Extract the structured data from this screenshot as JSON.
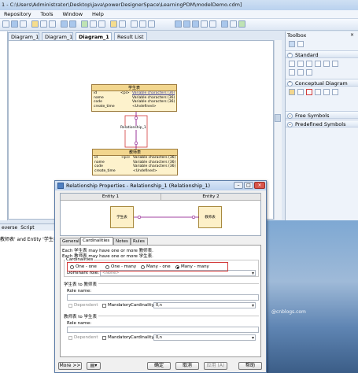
{
  "window": {
    "title": "1 - C:\\Users\\Administrator\\Desktop\\java\\powerDesignerSpace\\LearningPDM\\modelDemo.cdm]"
  },
  "menu": [
    "Repository",
    "Tools",
    "Window",
    "Help"
  ],
  "tabs": [
    {
      "label": "Diagram_1"
    },
    {
      "label": "Diagram_1"
    },
    {
      "label": "Diagram_1"
    },
    {
      "label": "Result List"
    }
  ],
  "diagram": {
    "entity_top": {
      "name": "学生表",
      "rows": [
        {
          "name": "id",
          "key": "<pi>",
          "type": "Variable characters (36)"
        },
        {
          "name": "name",
          "key": "",
          "type": "Variable characters (36)"
        },
        {
          "name": "code",
          "key": "",
          "type": "Variable characters (36)"
        },
        {
          "name": "create_time",
          "key": "",
          "type": "<Undefined>"
        }
      ]
    },
    "relationship_label": "Relationship_1",
    "entity_bottom": {
      "name": "教师表",
      "rows": [
        {
          "name": "id",
          "key": "<pi>",
          "type": "Variable characters (36)"
        },
        {
          "name": "name",
          "key": "",
          "type": "Variable characters (36)"
        },
        {
          "name": "code",
          "key": "",
          "type": "Variable characters (36)"
        },
        {
          "name": "create_time",
          "key": "",
          "type": "<Undefined>"
        }
      ]
    }
  },
  "toolbox": {
    "title": "Toolbox",
    "sections": [
      {
        "label": "Standard",
        "collapsed": false
      },
      {
        "label": "Conceptual Diagram",
        "collapsed": false
      },
      {
        "label": "Free Symbols",
        "collapsed": true
      },
      {
        "label": "Predefined Symbols",
        "collapsed": true
      }
    ]
  },
  "bottom_panel": {
    "tabs": [
      "everse",
      "Script"
    ],
    "output_text": "教师表' and Entity '学生表"
  },
  "watermark": "@cnblogs.com",
  "dialog": {
    "title": "Relationship Properties - Relationship_1 (Relationship_1)",
    "preview": {
      "entity1_header": "Entity 1",
      "entity2_header": "Entity 2",
      "entity1": "学生表",
      "entity2": "教师表"
    },
    "tabs": [
      "General",
      "Cardinalities",
      "Notes",
      "Rules"
    ],
    "active_tab": "Cardinalities",
    "description_line1": "Each 学生表 may have one or more 教师表.",
    "description_line2": "Each 教师表 may have one or more 学生表.",
    "cardinality_group_label": "Cardinalities",
    "cardinality_options": [
      "One - one",
      "One - many",
      "Many - one",
      "Many - many"
    ],
    "cardinality_selected": "Many - many",
    "dominant_role_label": "Dominant role:",
    "dominant_role_value": "<None>",
    "role1": {
      "heading": "学生表 to 教师表",
      "role_name_label": "Role name:",
      "role_name_value": "",
      "dependent_label": "Dependent",
      "mandatory_label": "Mandatory",
      "cardinality_label": "Cardinality:",
      "cardinality_value": "0,n"
    },
    "role2": {
      "heading": "教师表 to 学生表",
      "role_name_label": "Role name:",
      "role_name_value": "",
      "dependent_label": "Dependent",
      "mandatory_label": "Mandatory",
      "cardinality_label": "Cardinality:",
      "cardinality_value": "0,n"
    },
    "buttons": {
      "more": "More >>",
      "ok": "确定",
      "cancel": "取消",
      "apply": "应用 (A)",
      "help": "帮助"
    }
  },
  "colors": {
    "entity_fill": "#fdf2cc",
    "entity_header": "#f2d68e",
    "highlight": "#d23b3b",
    "link": "#800080"
  }
}
